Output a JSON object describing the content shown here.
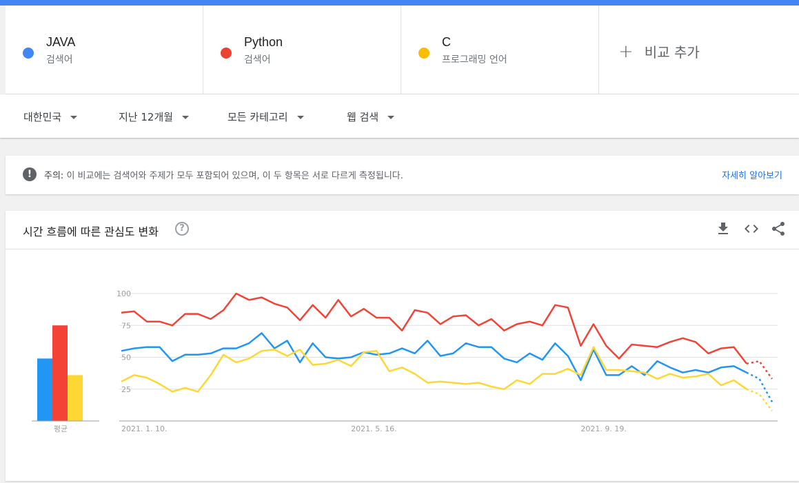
{
  "terms": [
    {
      "name": "JAVA",
      "type": "검색어",
      "color": "#4285f4"
    },
    {
      "name": "Python",
      "type": "검색어",
      "color": "#ea4335"
    },
    {
      "name": "C",
      "type": "프로그래밍 언어",
      "color": "#fbbc04"
    }
  ],
  "add_compare": {
    "icon": "plus-icon",
    "label": "비교 추가"
  },
  "filters": {
    "region": "대한민국",
    "period": "지난 12개월",
    "category": "모든 카테고리",
    "search_type": "웹 검색"
  },
  "notice": {
    "icon": "exclamation-icon",
    "prefix": "주의:",
    "text": "이 비교에는 검색어와 주제가 모두 포함되어 있으며, 이 두 항목은 서로 다르게 측정됩니다.",
    "link": "자세히 알아보기"
  },
  "chart_card": {
    "title": "시간 흐름에 따른 관심도 변화",
    "help_icon": "question-icon",
    "actions": [
      "download-icon",
      "embed-code-icon",
      "share-icon"
    ]
  },
  "chart_data": {
    "type": "line",
    "ylim": [
      0,
      100
    ],
    "yticks": [
      "100",
      "75",
      "50",
      "25"
    ],
    "xtick_labels": [
      {
        "index": 0,
        "label": "2021. 1. 10."
      },
      {
        "index": 18,
        "label": "2021. 5. 16."
      },
      {
        "index": 36,
        "label": "2021. 9. 19."
      }
    ],
    "partial_points": 2,
    "average_label": "평균",
    "series": [
      {
        "name": "JAVA",
        "color": "#2196f3",
        "average": 49,
        "values": [
          55,
          57,
          58,
          58,
          47,
          52,
          52,
          53,
          57,
          57,
          61,
          69,
          57,
          63,
          46,
          61,
          50,
          49,
          50,
          54,
          52,
          53,
          57,
          53,
          63,
          51,
          53,
          61,
          58,
          58,
          49,
          46,
          53,
          48,
          61,
          51,
          32,
          56,
          36,
          36,
          43,
          36,
          47,
          42,
          38,
          40,
          38,
          42,
          43,
          38,
          33,
          15
        ]
      },
      {
        "name": "Python",
        "color": "#f44336",
        "average": 75,
        "values": [
          85,
          86,
          78,
          78,
          75,
          84,
          84,
          80,
          87,
          100,
          95,
          97,
          92,
          89,
          79,
          91,
          81,
          95,
          82,
          88,
          81,
          81,
          71,
          87,
          85,
          76,
          82,
          83,
          75,
          80,
          71,
          76,
          78,
          75,
          91,
          89,
          59,
          76,
          59,
          49,
          60,
          59,
          58,
          62,
          65,
          62,
          53,
          57,
          58,
          45,
          47,
          33
        ]
      },
      {
        "name": "C",
        "color": "#fdd835",
        "average": 36,
        "values": [
          31,
          36,
          34,
          29,
          23,
          26,
          23,
          36,
          52,
          46,
          49,
          55,
          56,
          51,
          56,
          44,
          45,
          48,
          43,
          54,
          55,
          39,
          42,
          37,
          30,
          31,
          30,
          29,
          30,
          27,
          25,
          32,
          29,
          37,
          37,
          41,
          36,
          58,
          40,
          40,
          39,
          38,
          33,
          37,
          34,
          35,
          37,
          28,
          32,
          25,
          21,
          8
        ]
      }
    ]
  }
}
